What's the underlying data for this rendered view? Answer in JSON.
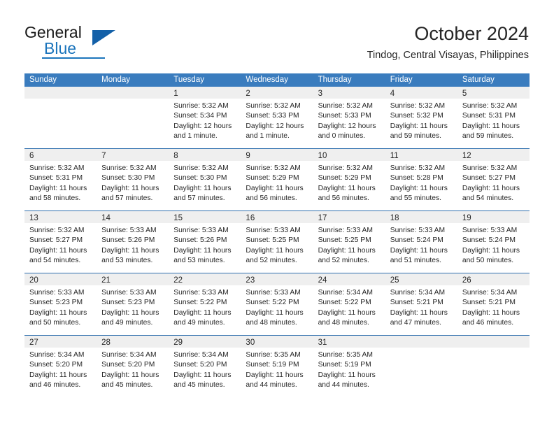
{
  "brand": {
    "name_part1": "General",
    "name_part2": "Blue",
    "logo_icon": "triangle-logo-icon"
  },
  "header": {
    "title": "October 2024",
    "location": "Tindog, Central Visayas, Philippines"
  },
  "colors": {
    "header_blue": "#3a7cbe",
    "divider_blue": "#2f6fae",
    "date_band_gray": "#efefef",
    "brand_blue": "#1c75bc",
    "text": "#262626"
  },
  "weekdays": [
    "Sunday",
    "Monday",
    "Tuesday",
    "Wednesday",
    "Thursday",
    "Friday",
    "Saturday"
  ],
  "weeks": [
    [
      {
        "empty": true
      },
      {
        "empty": true
      },
      {
        "day": "1",
        "sunrise": "Sunrise: 5:32 AM",
        "sunset": "Sunset: 5:34 PM",
        "daylight1": "Daylight: 12 hours",
        "daylight2": "and 1 minute."
      },
      {
        "day": "2",
        "sunrise": "Sunrise: 5:32 AM",
        "sunset": "Sunset: 5:33 PM",
        "daylight1": "Daylight: 12 hours",
        "daylight2": "and 1 minute."
      },
      {
        "day": "3",
        "sunrise": "Sunrise: 5:32 AM",
        "sunset": "Sunset: 5:33 PM",
        "daylight1": "Daylight: 12 hours",
        "daylight2": "and 0 minutes."
      },
      {
        "day": "4",
        "sunrise": "Sunrise: 5:32 AM",
        "sunset": "Sunset: 5:32 PM",
        "daylight1": "Daylight: 11 hours",
        "daylight2": "and 59 minutes."
      },
      {
        "day": "5",
        "sunrise": "Sunrise: 5:32 AM",
        "sunset": "Sunset: 5:31 PM",
        "daylight1": "Daylight: 11 hours",
        "daylight2": "and 59 minutes."
      }
    ],
    [
      {
        "day": "6",
        "sunrise": "Sunrise: 5:32 AM",
        "sunset": "Sunset: 5:31 PM",
        "daylight1": "Daylight: 11 hours",
        "daylight2": "and 58 minutes."
      },
      {
        "day": "7",
        "sunrise": "Sunrise: 5:32 AM",
        "sunset": "Sunset: 5:30 PM",
        "daylight1": "Daylight: 11 hours",
        "daylight2": "and 57 minutes."
      },
      {
        "day": "8",
        "sunrise": "Sunrise: 5:32 AM",
        "sunset": "Sunset: 5:30 PM",
        "daylight1": "Daylight: 11 hours",
        "daylight2": "and 57 minutes."
      },
      {
        "day": "9",
        "sunrise": "Sunrise: 5:32 AM",
        "sunset": "Sunset: 5:29 PM",
        "daylight1": "Daylight: 11 hours",
        "daylight2": "and 56 minutes."
      },
      {
        "day": "10",
        "sunrise": "Sunrise: 5:32 AM",
        "sunset": "Sunset: 5:29 PM",
        "daylight1": "Daylight: 11 hours",
        "daylight2": "and 56 minutes."
      },
      {
        "day": "11",
        "sunrise": "Sunrise: 5:32 AM",
        "sunset": "Sunset: 5:28 PM",
        "daylight1": "Daylight: 11 hours",
        "daylight2": "and 55 minutes."
      },
      {
        "day": "12",
        "sunrise": "Sunrise: 5:32 AM",
        "sunset": "Sunset: 5:27 PM",
        "daylight1": "Daylight: 11 hours",
        "daylight2": "and 54 minutes."
      }
    ],
    [
      {
        "day": "13",
        "sunrise": "Sunrise: 5:32 AM",
        "sunset": "Sunset: 5:27 PM",
        "daylight1": "Daylight: 11 hours",
        "daylight2": "and 54 minutes."
      },
      {
        "day": "14",
        "sunrise": "Sunrise: 5:33 AM",
        "sunset": "Sunset: 5:26 PM",
        "daylight1": "Daylight: 11 hours",
        "daylight2": "and 53 minutes."
      },
      {
        "day": "15",
        "sunrise": "Sunrise: 5:33 AM",
        "sunset": "Sunset: 5:26 PM",
        "daylight1": "Daylight: 11 hours",
        "daylight2": "and 53 minutes."
      },
      {
        "day": "16",
        "sunrise": "Sunrise: 5:33 AM",
        "sunset": "Sunset: 5:25 PM",
        "daylight1": "Daylight: 11 hours",
        "daylight2": "and 52 minutes."
      },
      {
        "day": "17",
        "sunrise": "Sunrise: 5:33 AM",
        "sunset": "Sunset: 5:25 PM",
        "daylight1": "Daylight: 11 hours",
        "daylight2": "and 52 minutes."
      },
      {
        "day": "18",
        "sunrise": "Sunrise: 5:33 AM",
        "sunset": "Sunset: 5:24 PM",
        "daylight1": "Daylight: 11 hours",
        "daylight2": "and 51 minutes."
      },
      {
        "day": "19",
        "sunrise": "Sunrise: 5:33 AM",
        "sunset": "Sunset: 5:24 PM",
        "daylight1": "Daylight: 11 hours",
        "daylight2": "and 50 minutes."
      }
    ],
    [
      {
        "day": "20",
        "sunrise": "Sunrise: 5:33 AM",
        "sunset": "Sunset: 5:23 PM",
        "daylight1": "Daylight: 11 hours",
        "daylight2": "and 50 minutes."
      },
      {
        "day": "21",
        "sunrise": "Sunrise: 5:33 AM",
        "sunset": "Sunset: 5:23 PM",
        "daylight1": "Daylight: 11 hours",
        "daylight2": "and 49 minutes."
      },
      {
        "day": "22",
        "sunrise": "Sunrise: 5:33 AM",
        "sunset": "Sunset: 5:22 PM",
        "daylight1": "Daylight: 11 hours",
        "daylight2": "and 49 minutes."
      },
      {
        "day": "23",
        "sunrise": "Sunrise: 5:33 AM",
        "sunset": "Sunset: 5:22 PM",
        "daylight1": "Daylight: 11 hours",
        "daylight2": "and 48 minutes."
      },
      {
        "day": "24",
        "sunrise": "Sunrise: 5:34 AM",
        "sunset": "Sunset: 5:22 PM",
        "daylight1": "Daylight: 11 hours",
        "daylight2": "and 48 minutes."
      },
      {
        "day": "25",
        "sunrise": "Sunrise: 5:34 AM",
        "sunset": "Sunset: 5:21 PM",
        "daylight1": "Daylight: 11 hours",
        "daylight2": "and 47 minutes."
      },
      {
        "day": "26",
        "sunrise": "Sunrise: 5:34 AM",
        "sunset": "Sunset: 5:21 PM",
        "daylight1": "Daylight: 11 hours",
        "daylight2": "and 46 minutes."
      }
    ],
    [
      {
        "day": "27",
        "sunrise": "Sunrise: 5:34 AM",
        "sunset": "Sunset: 5:20 PM",
        "daylight1": "Daylight: 11 hours",
        "daylight2": "and 46 minutes."
      },
      {
        "day": "28",
        "sunrise": "Sunrise: 5:34 AM",
        "sunset": "Sunset: 5:20 PM",
        "daylight1": "Daylight: 11 hours",
        "daylight2": "and 45 minutes."
      },
      {
        "day": "29",
        "sunrise": "Sunrise: 5:34 AM",
        "sunset": "Sunset: 5:20 PM",
        "daylight1": "Daylight: 11 hours",
        "daylight2": "and 45 minutes."
      },
      {
        "day": "30",
        "sunrise": "Sunrise: 5:35 AM",
        "sunset": "Sunset: 5:19 PM",
        "daylight1": "Daylight: 11 hours",
        "daylight2": "and 44 minutes."
      },
      {
        "day": "31",
        "sunrise": "Sunrise: 5:35 AM",
        "sunset": "Sunset: 5:19 PM",
        "daylight1": "Daylight: 11 hours",
        "daylight2": "and 44 minutes."
      },
      {
        "empty": true
      },
      {
        "empty": true
      }
    ]
  ]
}
